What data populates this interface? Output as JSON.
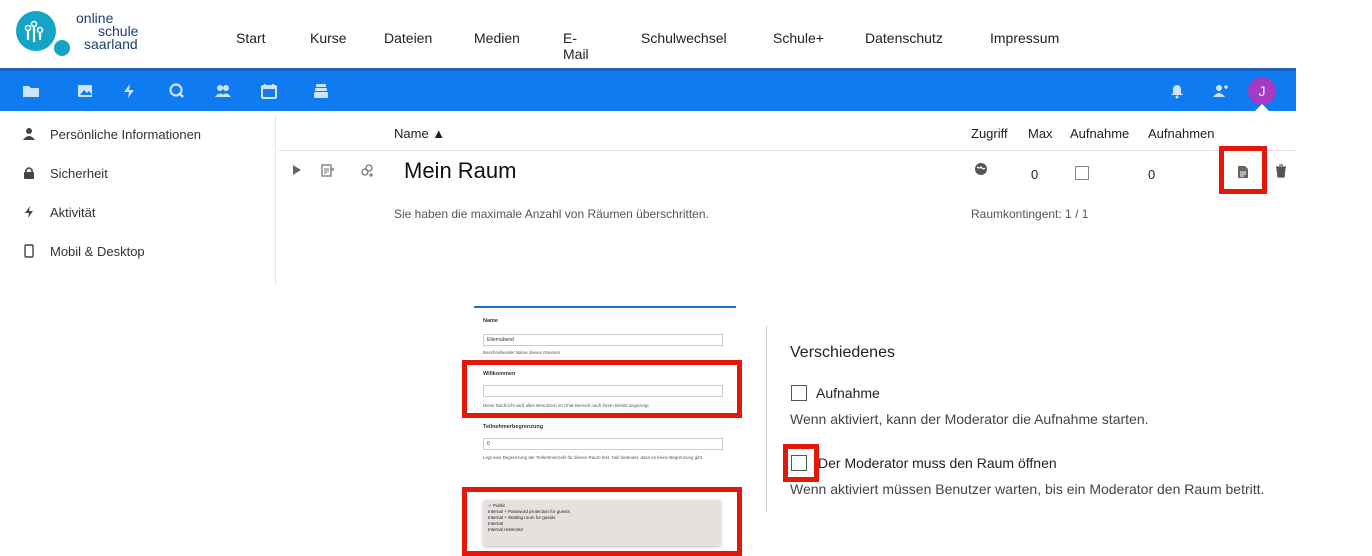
{
  "site": {
    "logo_line1": "online",
    "logo_line2": "schule",
    "logo_line3": "saarland",
    "nav": [
      "Start",
      "Kurse",
      "Dateien",
      "Medien",
      "E-Mail",
      "Schulwechsel",
      "Schule+",
      "Datenschutz",
      "Impressum"
    ]
  },
  "appbar": {
    "apps": [
      "folder-icon",
      "image-icon",
      "activity-icon",
      "search-icon",
      "contacts-icon",
      "calendar-icon",
      "deck-icon"
    ],
    "right_icons": [
      "notifications-icon",
      "contacts-menu-icon"
    ],
    "avatar_letter": "J",
    "avatar_color": "#a63ac4",
    "accent": "#0f7bf0"
  },
  "sidebar": {
    "items": [
      {
        "label": "Persönliche Informationen",
        "icon": "user-icon"
      },
      {
        "label": "Sicherheit",
        "icon": "lock-icon"
      },
      {
        "label": "Aktivität",
        "icon": "activity-icon"
      },
      {
        "label": "Mobil & Desktop",
        "icon": "phone-icon"
      }
    ]
  },
  "table": {
    "headers": {
      "name": "Name ▲",
      "access": "Zugriff",
      "max": "Max",
      "record": "Aufnahme",
      "recordings": "Aufnahmen"
    },
    "room": {
      "name": "Mein Raum",
      "max": "0",
      "recordings": "0"
    },
    "limit_message": "Sie haben die maximale Anzahl von Räumen überschritten.",
    "quota": "Raumkontingent: 1 / 1"
  },
  "form": {
    "name_label": "Name",
    "name_value": "Elternabend",
    "name_help": "Beschreibender Name dieses Raumes",
    "welcome_label": "Willkommen",
    "welcome_value": "",
    "welcome_help": "Diese Nachricht wird allen Benutzern im Chat-Bereich nach ihrem Beitritt angezeigt.",
    "limit_label": "Teilnehmerbegrenzung",
    "limit_value": "0",
    "limit_help": "Legt eine Begrenzung der Teilnehmerzahl für diesen Raum fest. Null bedeutet, dass es keine Begrenzung gibt.",
    "access_options": [
      "✓ Public",
      "Internal + Password protection for guests",
      "Internal + Waiting room for guests",
      "Internal",
      "Internal restricted"
    ]
  },
  "misc": {
    "title": "Verschiedenes",
    "record_label": "Aufnahme",
    "record_desc": "Wenn aktiviert, kann der Moderator die Aufnahme starten.",
    "moderator_label": "Der Moderator muss den Raum öffnen",
    "moderator_desc": "Wenn aktiviert müssen Benutzer warten, bis ein Moderator den Raum betritt."
  },
  "colors": {
    "highlight_red": "#e3170a",
    "logo_blue": "#1c3f6e",
    "logo_teal": "#16a3c8"
  }
}
